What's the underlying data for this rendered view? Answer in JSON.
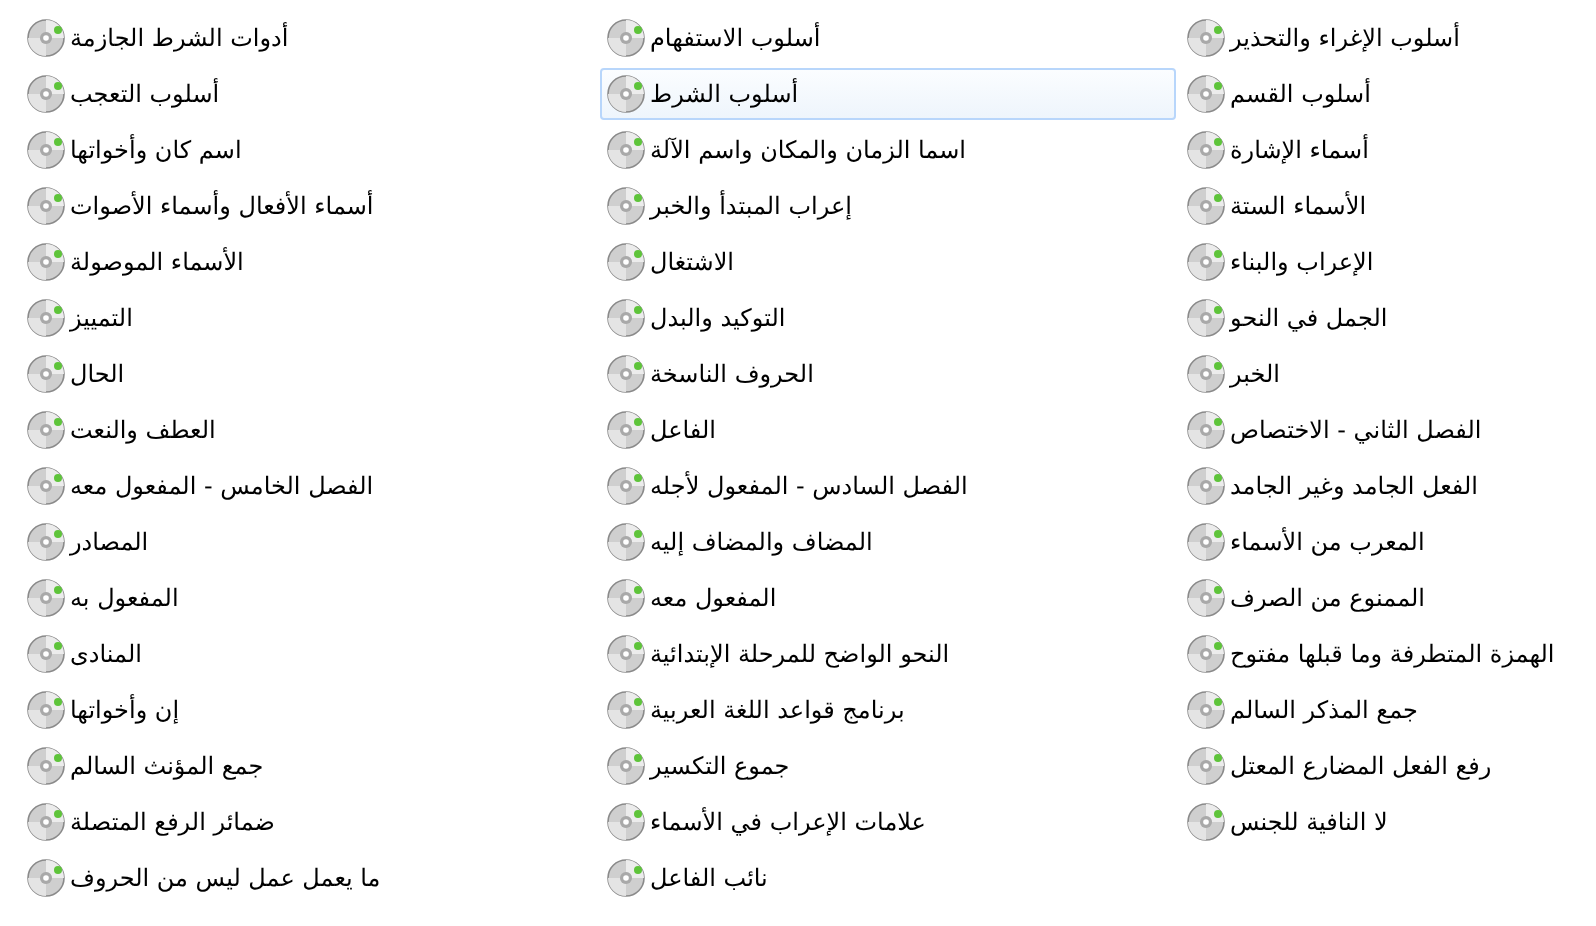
{
  "columns": [
    {
      "items": [
        {
          "label": "أسلوب الإغراء والتحذير",
          "selected": false
        },
        {
          "label": "أسلوب القسم",
          "selected": false
        },
        {
          "label": "أسماء الإشارة",
          "selected": false
        },
        {
          "label": "الأسماء الستة",
          "selected": false
        },
        {
          "label": "الإعراب والبناء",
          "selected": false
        },
        {
          "label": "الجمل في النحو",
          "selected": false
        },
        {
          "label": "الخبر",
          "selected": false
        },
        {
          "label": "الفصل الثاني - الاختصاص",
          "selected": false
        },
        {
          "label": "الفعل الجامد وغير الجامد",
          "selected": false
        },
        {
          "label": "المعرب من الأسماء",
          "selected": false
        },
        {
          "label": "الممنوع من الصرف",
          "selected": false
        },
        {
          "label": "الهمزة المتطرفة وما قبلها مفتوح",
          "selected": false
        },
        {
          "label": "جمع المذكر السالم",
          "selected": false
        },
        {
          "label": "رفع الفعل المضارع المعتل",
          "selected": false
        },
        {
          "label": "لا النافية للجنس",
          "selected": false
        }
      ]
    },
    {
      "items": [
        {
          "label": "أسلوب الاستفهام",
          "selected": false
        },
        {
          "label": "أسلوب الشرط",
          "selected": true
        },
        {
          "label": "اسما الزمان والمكان واسم الآلة",
          "selected": false
        },
        {
          "label": "إعراب المبتدأ والخبر",
          "selected": false
        },
        {
          "label": "الاشتغال",
          "selected": false
        },
        {
          "label": "التوكيد والبدل",
          "selected": false
        },
        {
          "label": "الحروف الناسخة",
          "selected": false
        },
        {
          "label": "الفاعل",
          "selected": false
        },
        {
          "label": "الفصل السادس - المفعول لأجله",
          "selected": false
        },
        {
          "label": "المضاف والمضاف إليه",
          "selected": false
        },
        {
          "label": "المفعول معه",
          "selected": false
        },
        {
          "label": "النحو الواضح للمرحلة الإبتدائية",
          "selected": false
        },
        {
          "label": "برنامج قواعد اللغة العربية",
          "selected": false
        },
        {
          "label": "جموع التكسير",
          "selected": false
        },
        {
          "label": "علامات الإعراب في الأسماء",
          "selected": false
        },
        {
          "label": "نائب الفاعل",
          "selected": false
        }
      ]
    },
    {
      "items": [
        {
          "label": "أدوات الشرط الجازمة",
          "selected": false
        },
        {
          "label": "أسلوب التعجب",
          "selected": false
        },
        {
          "label": "اسم كان وأخواتها",
          "selected": false
        },
        {
          "label": "أسماء الأفعال وأسماء الأصوات",
          "selected": false
        },
        {
          "label": "الأسماء الموصولة",
          "selected": false
        },
        {
          "label": "التمييز",
          "selected": false
        },
        {
          "label": "الحال",
          "selected": false
        },
        {
          "label": "العطف والنعت",
          "selected": false
        },
        {
          "label": "الفصل الخامس - المفعول معه",
          "selected": false
        },
        {
          "label": "المصادر",
          "selected": false
        },
        {
          "label": "المفعول به",
          "selected": false
        },
        {
          "label": "المنادى",
          "selected": false
        },
        {
          "label": "إن وأخواتها",
          "selected": false
        },
        {
          "label": "جمع المؤنث السالم",
          "selected": false
        },
        {
          "label": "ضمائر الرفع المتصلة",
          "selected": false
        },
        {
          "label": "ما يعمل عمل ليس من الحروف",
          "selected": false
        }
      ]
    }
  ]
}
